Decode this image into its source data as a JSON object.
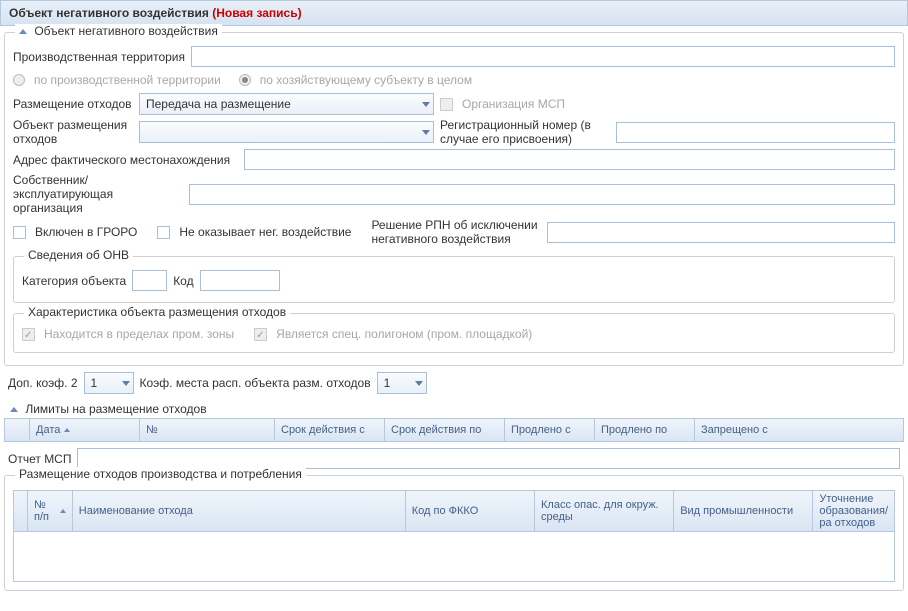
{
  "header": {
    "title": "Объект негативного воздействия",
    "new_record": "(Новая запись)"
  },
  "main": {
    "section_title": "Объект негативного воздействия",
    "territory_label": "Производственная территория",
    "radio_territory": "по производственной территории",
    "radio_subject": "по хозяйствующему субъекту в целом",
    "disposal_label": "Размещение отходов",
    "disposal_value": "Передача на размещение",
    "org_msp_label": "Организация МСП",
    "disposal_obj_label": "Объект размещения отходов",
    "reg_number_label": "Регистрационный номер (в случае его присвоения)",
    "address_label": "Адрес фактического местонахождения",
    "owner_label": "Собственник/эксплуатирующая организация",
    "groro_label": "Включен в ГРОРО",
    "no_neg_label": "Не оказывает нег. воздействие",
    "rpn_label": "Решение РПН об исключении негативного воздействия"
  },
  "onv": {
    "section_title": "Сведения об ОНВ",
    "category_label": "Категория объекта",
    "code_label": "Код"
  },
  "char": {
    "section_title": "Характеристика объекта размещения отходов",
    "in_zone_label": "Находится в пределах пром. зоны",
    "polygon_label": "Является спец. полигоном (пром. площадкой)"
  },
  "coef": {
    "dop_label": "Доп. коэф. 2",
    "dop_value": "1",
    "place_label": "Коэф. места расп. объекта разм. отходов",
    "place_value": "1"
  },
  "limits": {
    "title": "Лимиты на размещение отходов",
    "cols": {
      "date": "Дата",
      "num": "№",
      "from": "Срок действия с",
      "to": "Срок действия по",
      "ext_from": "Продлено с",
      "ext_to": "Продлено по",
      "banned_from": "Запрещено с"
    }
  },
  "report": {
    "label": "Отчет МСП"
  },
  "placement": {
    "section_title": "Размещение отходов производства и потребления",
    "cols": {
      "num": "№ п/п",
      "name": "Наименование отхода",
      "fkko": "Код по ФККО",
      "hazard": "Класс опас. для окруж. среды",
      "industry": "Вид промышленности",
      "clarif": "Уточнение образования/ра отходов"
    }
  }
}
